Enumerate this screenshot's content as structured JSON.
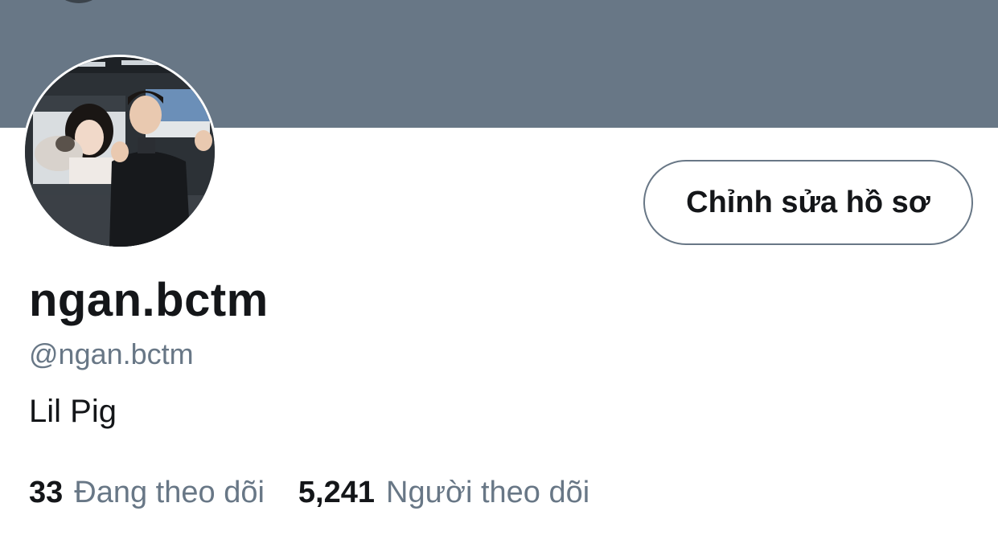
{
  "profile": {
    "display_name": "ngan.bctm",
    "handle": "@ngan.bctm",
    "bio": "Lil Pig"
  },
  "actions": {
    "edit_profile_label": "Chỉnh sửa hồ sơ"
  },
  "stats": {
    "following_count": "33",
    "following_label": "Đang theo dõi",
    "followers_count": "5,241",
    "followers_label": "Người theo dõi"
  },
  "colors": {
    "banner": "#687786",
    "text_primary": "#141619",
    "text_secondary": "#687786",
    "button_border": "#687786"
  }
}
